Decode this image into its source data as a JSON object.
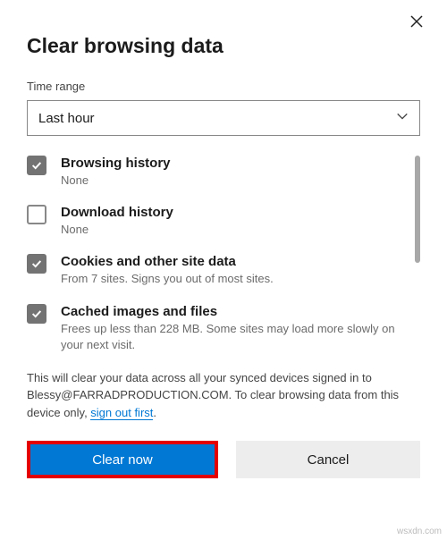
{
  "dialog": {
    "title": "Clear browsing data",
    "time_range_label": "Time range",
    "time_range_value": "Last hour",
    "items": [
      {
        "checked": true,
        "title": "Browsing history",
        "desc": "None"
      },
      {
        "checked": false,
        "title": "Download history",
        "desc": "None"
      },
      {
        "checked": true,
        "title": "Cookies and other site data",
        "desc": "From 7 sites. Signs you out of most sites."
      },
      {
        "checked": true,
        "title": "Cached images and files",
        "desc": "Frees up less than 228 MB. Some sites may load more slowly on your next visit."
      }
    ],
    "sync_note_pre": "This will clear your data across all your synced devices signed in to Blessy@FARRADPRODUCTION.COM. To clear browsing data from this device only, ",
    "sync_note_link": "sign out first",
    "sync_note_post": ".",
    "clear_label": "Clear now",
    "cancel_label": "Cancel"
  },
  "watermark": "wsxdn.com"
}
